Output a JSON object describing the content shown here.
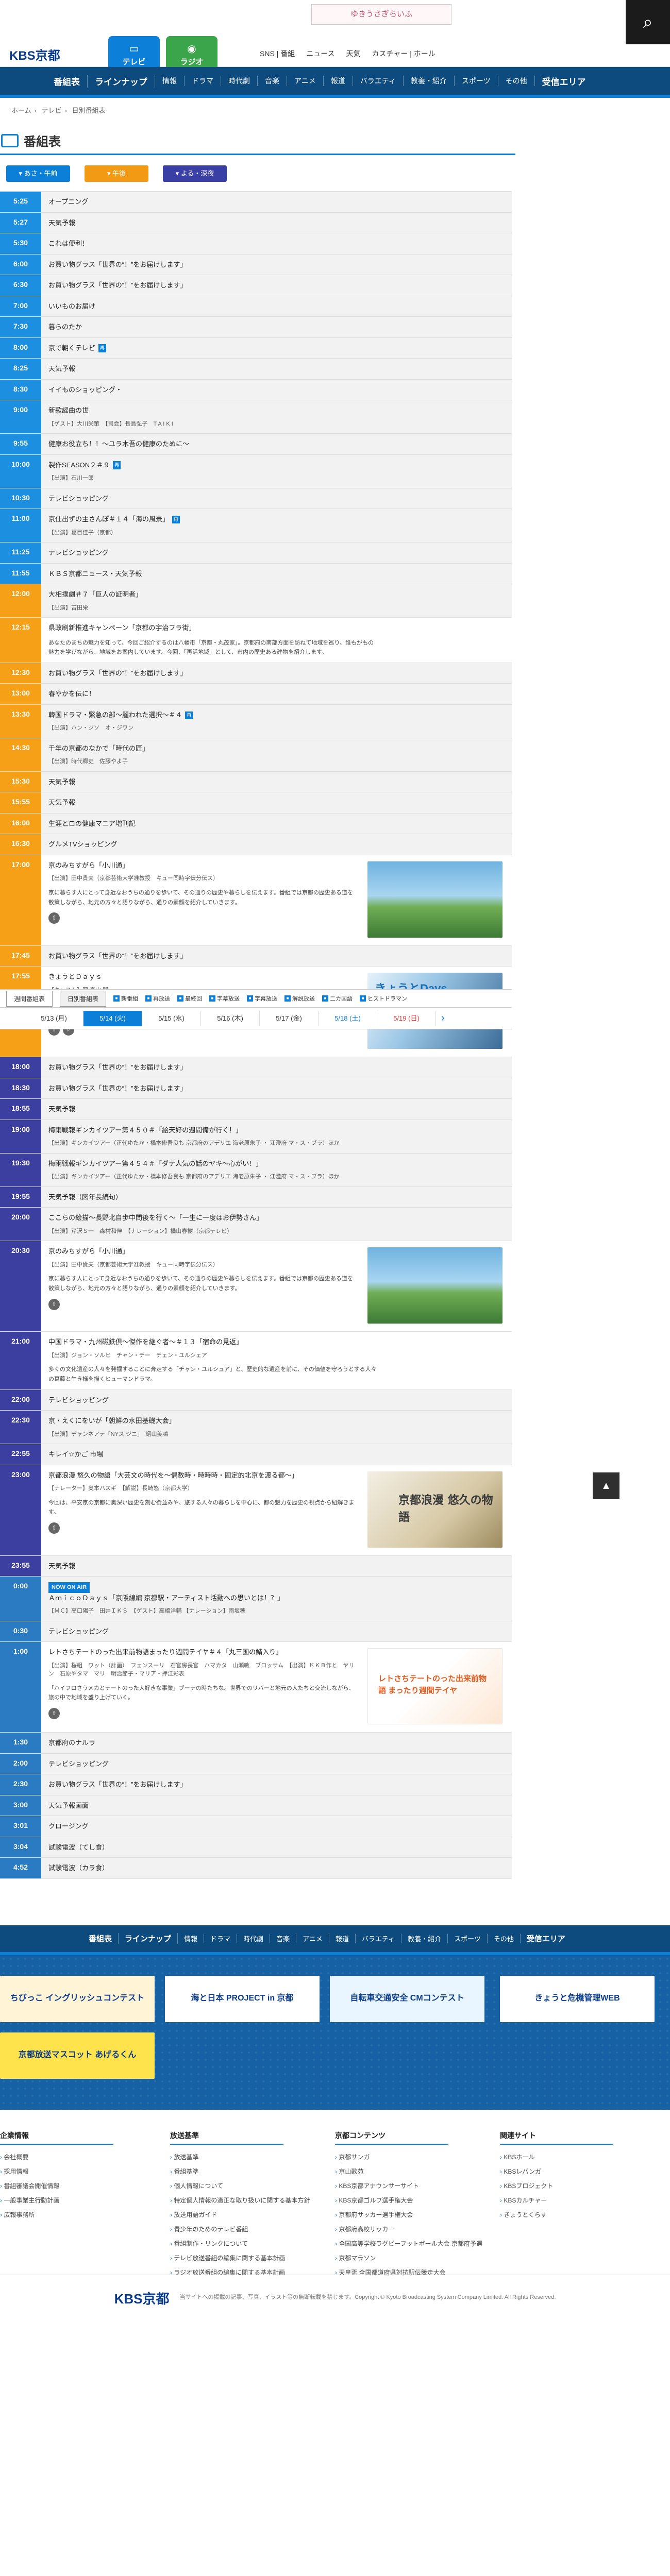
{
  "header": {
    "logo": "KBS京都",
    "tabs": [
      {
        "label": "テレビ",
        "icon": "tv-icon"
      },
      {
        "label": "ラジオ",
        "icon": "radio-icon"
      }
    ],
    "banner": "ゆきうさぎらいふ",
    "links": [
      "SNS | 番組",
      "ニュース",
      "天気",
      "カスチャー | ホール"
    ]
  },
  "nav": [
    "番組表",
    "ラインナップ",
    "情報",
    "ドラマ",
    "時代劇",
    "音楽",
    "アニメ",
    "報道",
    "バラエティ",
    "教養・紹介",
    "スポーツ",
    "その他",
    "受信エリア"
  ],
  "breadcrumb": [
    "ホーム",
    "テレビ",
    "日別番組表"
  ],
  "page_title": "番組表",
  "tod_buttons": [
    "あさ・午前",
    "午後",
    "よる・深夜"
  ],
  "legend": {
    "tabs": [
      "週間番組表",
      "日別番組表"
    ],
    "items": [
      "新番組",
      "再放送",
      "最終回",
      "字幕放送",
      "字幕放送",
      "解説放送",
      "二カ国語",
      "ヒストドラマン"
    ]
  },
  "dates": [
    "5/13 (月)",
    "5/14 (火)",
    "5/15 (水)",
    "5/16 (木)",
    "5/17 (金)",
    "5/18 (土)",
    "5/19 (日)"
  ],
  "schedule": [
    {
      "time": "5:25",
      "tod": "m",
      "title": "オープニング"
    },
    {
      "time": "5:27",
      "tod": "m",
      "title": "天気予報"
    },
    {
      "time": "5:30",
      "tod": "m",
      "title": "これは便利！"
    },
    {
      "time": "6:00",
      "tod": "m",
      "title": "お買い物グラス「世界の“！”をお届けします」"
    },
    {
      "time": "6:30",
      "tod": "m",
      "title": "お買い物グラス「世界の“！”をお届けします」"
    },
    {
      "time": "7:00",
      "tod": "m",
      "title": "いいものお届け"
    },
    {
      "time": "7:30",
      "tod": "m",
      "title": "暮らのたか"
    },
    {
      "time": "8:00",
      "tod": "m",
      "title": "京で朝くテレビ"
    },
    {
      "time": "8:25",
      "tod": "m",
      "title": "天気予報"
    },
    {
      "time": "8:30",
      "tod": "m",
      "title": "イイものショッピング・"
    },
    {
      "time": "9:00",
      "tod": "m",
      "title": "新歌謡曲の世",
      "meta": "【ゲスト】大川栄策　【司会】長島弘子　T A I K I"
    },
    {
      "time": "9:55",
      "tod": "m",
      "title": "健康お役立ち！！〜ユラ木吾の健康のために〜"
    },
    {
      "time": "10:00",
      "tod": "m",
      "title": "製作SEASON２＃９",
      "meta": "【出演】石川一郎"
    },
    {
      "time": "10:30",
      "tod": "m",
      "title": "テレビショッピング"
    },
    {
      "time": "11:00",
      "tod": "m",
      "title": "京仕出ずの主さんぽ＃１４「海の風景」",
      "meta": "【出演】葛目佳子（京都）"
    },
    {
      "time": "11:25",
      "tod": "m",
      "title": "テレビショッピング"
    },
    {
      "time": "11:55",
      "tod": "m",
      "title": "ＫＢＳ京都ニュース・天気予報"
    },
    {
      "time": "12:00",
      "tod": "d",
      "title": "大相撲劇＃７「巨人の証明者」",
      "meta": "【出演】吉田栄"
    },
    {
      "time": "12:15",
      "tod": "d",
      "title": "県政刷新推進キャンペーン「京都の宇治フラ街」",
      "desc": "あなたのまちの魅力を知って、今回ご紹介するのは八幡市「京都・丸茂家」。京都府の南部方面を訪ねて地域を巡り、誰もがもの魅力を学びながら、地域をお案内しています。今回、「再活地域」として、市内の歴史ある建物を紹介します。"
    },
    {
      "time": "12:30",
      "tod": "d",
      "title": "お買い物グラス「世界の“！”をお届けします」"
    },
    {
      "time": "13:00",
      "tod": "d",
      "title": "春やかを伝に！"
    },
    {
      "time": "13:30",
      "tod": "d",
      "title": "韓国ドラマ・緊急の部〜麗われた選択〜＃４",
      "meta": "【出演】ハン・ジソ　オ・ジワン"
    },
    {
      "time": "14:30",
      "tod": "d",
      "title": "千年の京都のなかで「時代の匠」",
      "meta": "【出演】時代郷史　佐藤やよ子"
    },
    {
      "time": "15:30",
      "tod": "d",
      "title": "天気予報"
    },
    {
      "time": "15:55",
      "tod": "d",
      "title": "天気予報"
    },
    {
      "time": "16:00",
      "tod": "d",
      "title": "生涯とロの健康マニア増刊記"
    },
    {
      "time": "16:30",
      "tod": "d",
      "title": "グルメTVショッピング"
    },
    {
      "time": "17:00",
      "tod": "d",
      "title": "京のみちすがら「小川通」",
      "meta": "【出演】田中貴夫（京都芸術大学准教授　キュー同時字伝分伝ス）",
      "desc": "京に暮らす人にとって身近なおうちの通りを歩いて、その通りの歴史や暮らしを伝えます。番組では京都の歴史ある道を散策しながら、地元の方々と語りながら、通りの素顔を紹介していきます。",
      "thumb": "scenic",
      "icons": 1
    },
    {
      "time": "17:45",
      "tod": "d",
      "title": "お買い物グラス「世界の“！”をお届けします」"
    },
    {
      "time": "17:55",
      "tod": "d",
      "title": "きょうとＤａｙｓ",
      "meta": "【キャスト】岡 真山 翼",
      "desc": "二世帯住居同然の家族が暮らすＫＢＳ京都の番組。高級料理と、それぞれ一つの家族の物語が交差する。日本の京都の四季を舞台に描きます。",
      "thumb": "drama",
      "icons": 2
    },
    {
      "time": "18:00",
      "tod": "n",
      "title": "お買い物グラス「世界の“！”をお届けします」"
    },
    {
      "time": "18:30",
      "tod": "n",
      "title": "お買い物グラス「世界の“！”をお届けします」"
    },
    {
      "time": "18:55",
      "tod": "n",
      "title": "天気予報"
    },
    {
      "time": "19:00",
      "tod": "n",
      "title": "梅雨戦報ギンカイツアー第４５０＃「絵天好の週間備が行く！」",
      "meta": "【出演】ギンカイツアー（正代ゆたか・橋本修吾良も 京都府のアデリエ 海老原朱子 ・ 江澄府 マ・ス・ブラ）ほか"
    },
    {
      "time": "19:30",
      "tod": "n",
      "title": "梅雨戦報ギンカイツアー第４５４＃「ダテ人気の話のヤキ〜心がい！」",
      "meta": "【出演】ギンカイツアー（正代ゆたか・橋本修吾良も 京都府のアデリエ 海老原朱子 ・ 江澄府 マ・ス・ブラ）ほか"
    },
    {
      "time": "19:55",
      "tod": "n",
      "title": "天気予報（図年長続句）"
    },
    {
      "time": "20:00",
      "tod": "n",
      "title": "ここらの絵描〜長野北自歩中問後を行く〜「一生に一度はお伊勢さん」",
      "meta": "【出演】芹沢Ｓ一　森村和伸　【ナレーション】橋山春樹（京都テレビ）"
    },
    {
      "time": "20:30",
      "tod": "n",
      "title": "京のみちすがら「小川通」",
      "meta": "【出演】田中貴夫（京都芸術大学准教授　キュー同時字伝分伝ス）",
      "desc": "京に暮らす人にとって身近なおうちの通りを歩いて、その通りの歴史や暮らしを伝えます。番組では京都の歴史ある道を散策しながら、地元の方々と語りながら、通りの素顔を紹介していきます。",
      "thumb": "scenic",
      "icons": 1
    },
    {
      "time": "21:00",
      "tod": "n",
      "title": "中国ドラマ・九州磁鉄倶〜傑作を継ぐ者〜＃１３「宿命の見返」",
      "meta": "【出演】ジョン・ソルヒ　チャン・チー　チェン・ユルシェア",
      "desc": "多くの文化遺産の人々を発掘することに奔走する「チャン・ユルシュア」と、歴史的な遺産を前に、その価値を守ろうとする人々の葛藤と生き様を描くヒューマンドラマ。"
    },
    {
      "time": "22:00",
      "tod": "n",
      "title": "テレビショッピング"
    },
    {
      "time": "22:30",
      "tod": "n",
      "title": "京・えくにをいが「朝鮮の水田基礎大会」",
      "meta": "【出演】チャンネアテ「NYス ジニ」　紹山美鳴"
    },
    {
      "time": "22:55",
      "tod": "n",
      "title": "キレイ☆かご 市場"
    },
    {
      "time": "23:00",
      "tod": "n",
      "title": "京都浪漫 悠久の物語「大芸文の時代を〜偶数時・時時時・固定的北京を渡る都〜」",
      "meta": "【ナレーター】奥本ハスギ　【解説】長崎悠（京都大学）",
      "desc": "今回は、平安京の京都に奥深い歴史を刻む街並みや、旅する人々の暮らしを中心に、都の魅力を歴史の視点から紐解きます。",
      "thumb": "kyoto",
      "icons": 1
    },
    {
      "time": "23:55",
      "tod": "n",
      "title": "天気予報"
    },
    {
      "time": "0:00",
      "tod": "mn",
      "title": "ＡｍｉｃｏＤａｙｓ「京阪線編 京都駅・アーティスト活動への思いとは！？」",
      "meta": "【ＭＣ】高口陽子　田井ＩＫＳ　【ゲスト】高橋洋輔 【ナレーション】雨坂穂",
      "now": true
    },
    {
      "time": "0:30",
      "tod": "mn",
      "title": "テレビショッピング"
    },
    {
      "time": "1:00",
      "tod": "mn",
      "title": "レトさちテートのった出来前物語まったり週間テイヤ＃４「丸三国の鯖入り」",
      "meta": "【出演】桜組　ワット（計画）　フェンスーリ　石官房長官　ハマカタ　山瀬敏　ブロッサム　【出演】ＫＫＢ作と　ヤリン　石原やタマ　マリ　明治節子・マリア・押江彩表",
      "desc": "「ハイフロさうメカとテートのった大好きな事業」ブーテの時たちな。世界でのリバーと地元の人たちと交流しながら、旅の中で地域を盛り上げていく。",
      "thumb": "teen",
      "icons": 1
    },
    {
      "time": "1:30",
      "tod": "mn",
      "title": "京都府のナルラ"
    },
    {
      "time": "2:00",
      "tod": "mn",
      "title": "テレビショッピング"
    },
    {
      "time": "2:30",
      "tod": "mn",
      "title": "お買い物グラス「世界の“！”をお届けします」"
    },
    {
      "time": "3:00",
      "tod": "mn",
      "title": "天気予報画面"
    },
    {
      "time": "3:01",
      "tod": "mn",
      "title": "クロージング"
    },
    {
      "time": "3:04",
      "tod": "mn",
      "title": "試験電波（てし食）"
    },
    {
      "time": "4:52",
      "tod": "mn",
      "title": "試験電波（カラ食）"
    }
  ],
  "thumb_texts": {
    "kyoto": "京都浪漫 悠久の物語",
    "teen": "レトさちテートのった出来前物語 まったり週間テイヤ",
    "drama": "きょうとDays"
  },
  "footer_nav": [
    "番組表",
    "ラインナップ",
    "情報",
    "ドラマ",
    "時代劇",
    "音楽",
    "アニメ",
    "報道",
    "バラエティ",
    "教養・紹介",
    "スポーツ",
    "その他",
    "受信エリア"
  ],
  "banners": [
    {
      "text": "ちびっこ イングリッシュコンテスト",
      "color": "#fff5d6"
    },
    {
      "text": "海と日本 PROJECT in 京都",
      "color": "#ffffff"
    },
    {
      "text": "自転車交通安全 CMコンテスト",
      "color": "#eaf6ff"
    },
    {
      "text": "きょうと危機管理WEB",
      "color": "#ffffff"
    },
    {
      "text": "京都放送マスコット あげるくん",
      "color": "#ffe34d"
    }
  ],
  "footer_cols": [
    {
      "title": "企業情報",
      "items": [
        "会社概要",
        "採用情報",
        "番組審議会開催情報",
        "一般事業主行動計画",
        "広報事務所"
      ]
    },
    {
      "title": "放送基準",
      "items": [
        "放送基準",
        "番組基準",
        "個人情報について",
        "特定個人情報の適正な取り扱いに関する基本方針",
        "放送用語ガイド",
        "青少年のためのテレビ番組",
        "番組制作・リンクについて",
        "テレビ放送番組の編集に関する基本計画",
        "ラジオ放送番組の編集に関する基本計画"
      ]
    },
    {
      "title": "京都コンテンツ",
      "items": [
        "京都サンガ",
        "京山歌苑",
        "KBS京都アナウンサーサイト",
        "KBS京都ゴルフ選手権大会",
        "京都府サッカー選手権大会",
        "京都府高校サッカー",
        "全国高等学校ラグビーフットボール大会 京都府予選",
        "京都マラソン",
        "天皇盃 全国都道府県対抗駅伝競走大会"
      ]
    },
    {
      "title": "関連サイト",
      "items": [
        "KBSホール",
        "KBSレバンガ",
        "KBSプロジェクト",
        "KBSカルチャー",
        "きょうとくらす"
      ]
    }
  ],
  "copyright": "当サイトへの掲載の記事、写真、イラスト等の無断転載を禁じます。Copyright © Kyoto Broadcasting System Company Limited. All Rights Reserved."
}
